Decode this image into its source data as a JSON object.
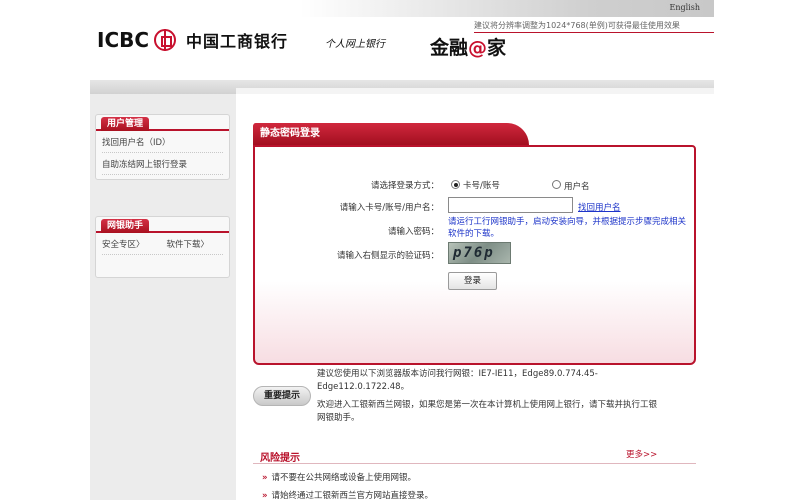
{
  "header": {
    "language_link": "English",
    "resolution_tip": "建议将分辨率调整为1024*768(单例)可获得最佳使用效果",
    "logo_text": "ICBC",
    "bank_name": "中国工商银行",
    "service_name": "个人网上银行",
    "brand_slogan_prefix": "金融",
    "brand_slogan_at": "@",
    "brand_slogan_suffix": "家"
  },
  "sidebar": {
    "user_mgmt": {
      "title": "用户管理",
      "items": [
        "找回用户名（ID）",
        "自助冻结网上银行登录"
      ]
    },
    "assistant": {
      "title": "网银助手",
      "items": [
        "安全专区〉",
        "软件下载〉"
      ]
    }
  },
  "login": {
    "title": "静态密码登录",
    "method_label": "请选择登录方式：",
    "method_options": [
      "卡号/账号",
      "用户名"
    ],
    "method_selected": "卡号/账号",
    "account_label": "请输入卡号/账号/用户名：",
    "account_value": "",
    "find_username_link": "找回用户名",
    "password_label": "请输入密码：",
    "password_tip": "请运行工行网银助手，启动安装向导，并根据提示步骤完成相关软件的下载。",
    "captcha_label": "请输入右侧显示的验证码：",
    "captcha_text": "p76p",
    "submit_label": "登录"
  },
  "notice": {
    "badge": "重要提示",
    "browser_tip_line1": "建议您使用以下浏览器版本访问我行网银：IE7-IE11，Edge89.0.774.45-",
    "browser_tip_line2": "Edge112.0.1722.48。",
    "welcome_line1": "欢迎进入工银新西兰网银，如果您是第一次在本计算机上使用网上银行，请下载并执行工银",
    "welcome_line2": "网银助手。"
  },
  "risk": {
    "title": "风险提示",
    "more": "更多>>",
    "items": [
      "请不要在公共网络或设备上使用网银。",
      "请始终通过工银新西兰官方网站直接登录。"
    ]
  },
  "colors": {
    "brand_red": "#b9132c",
    "link_blue": "#1d34c9"
  }
}
